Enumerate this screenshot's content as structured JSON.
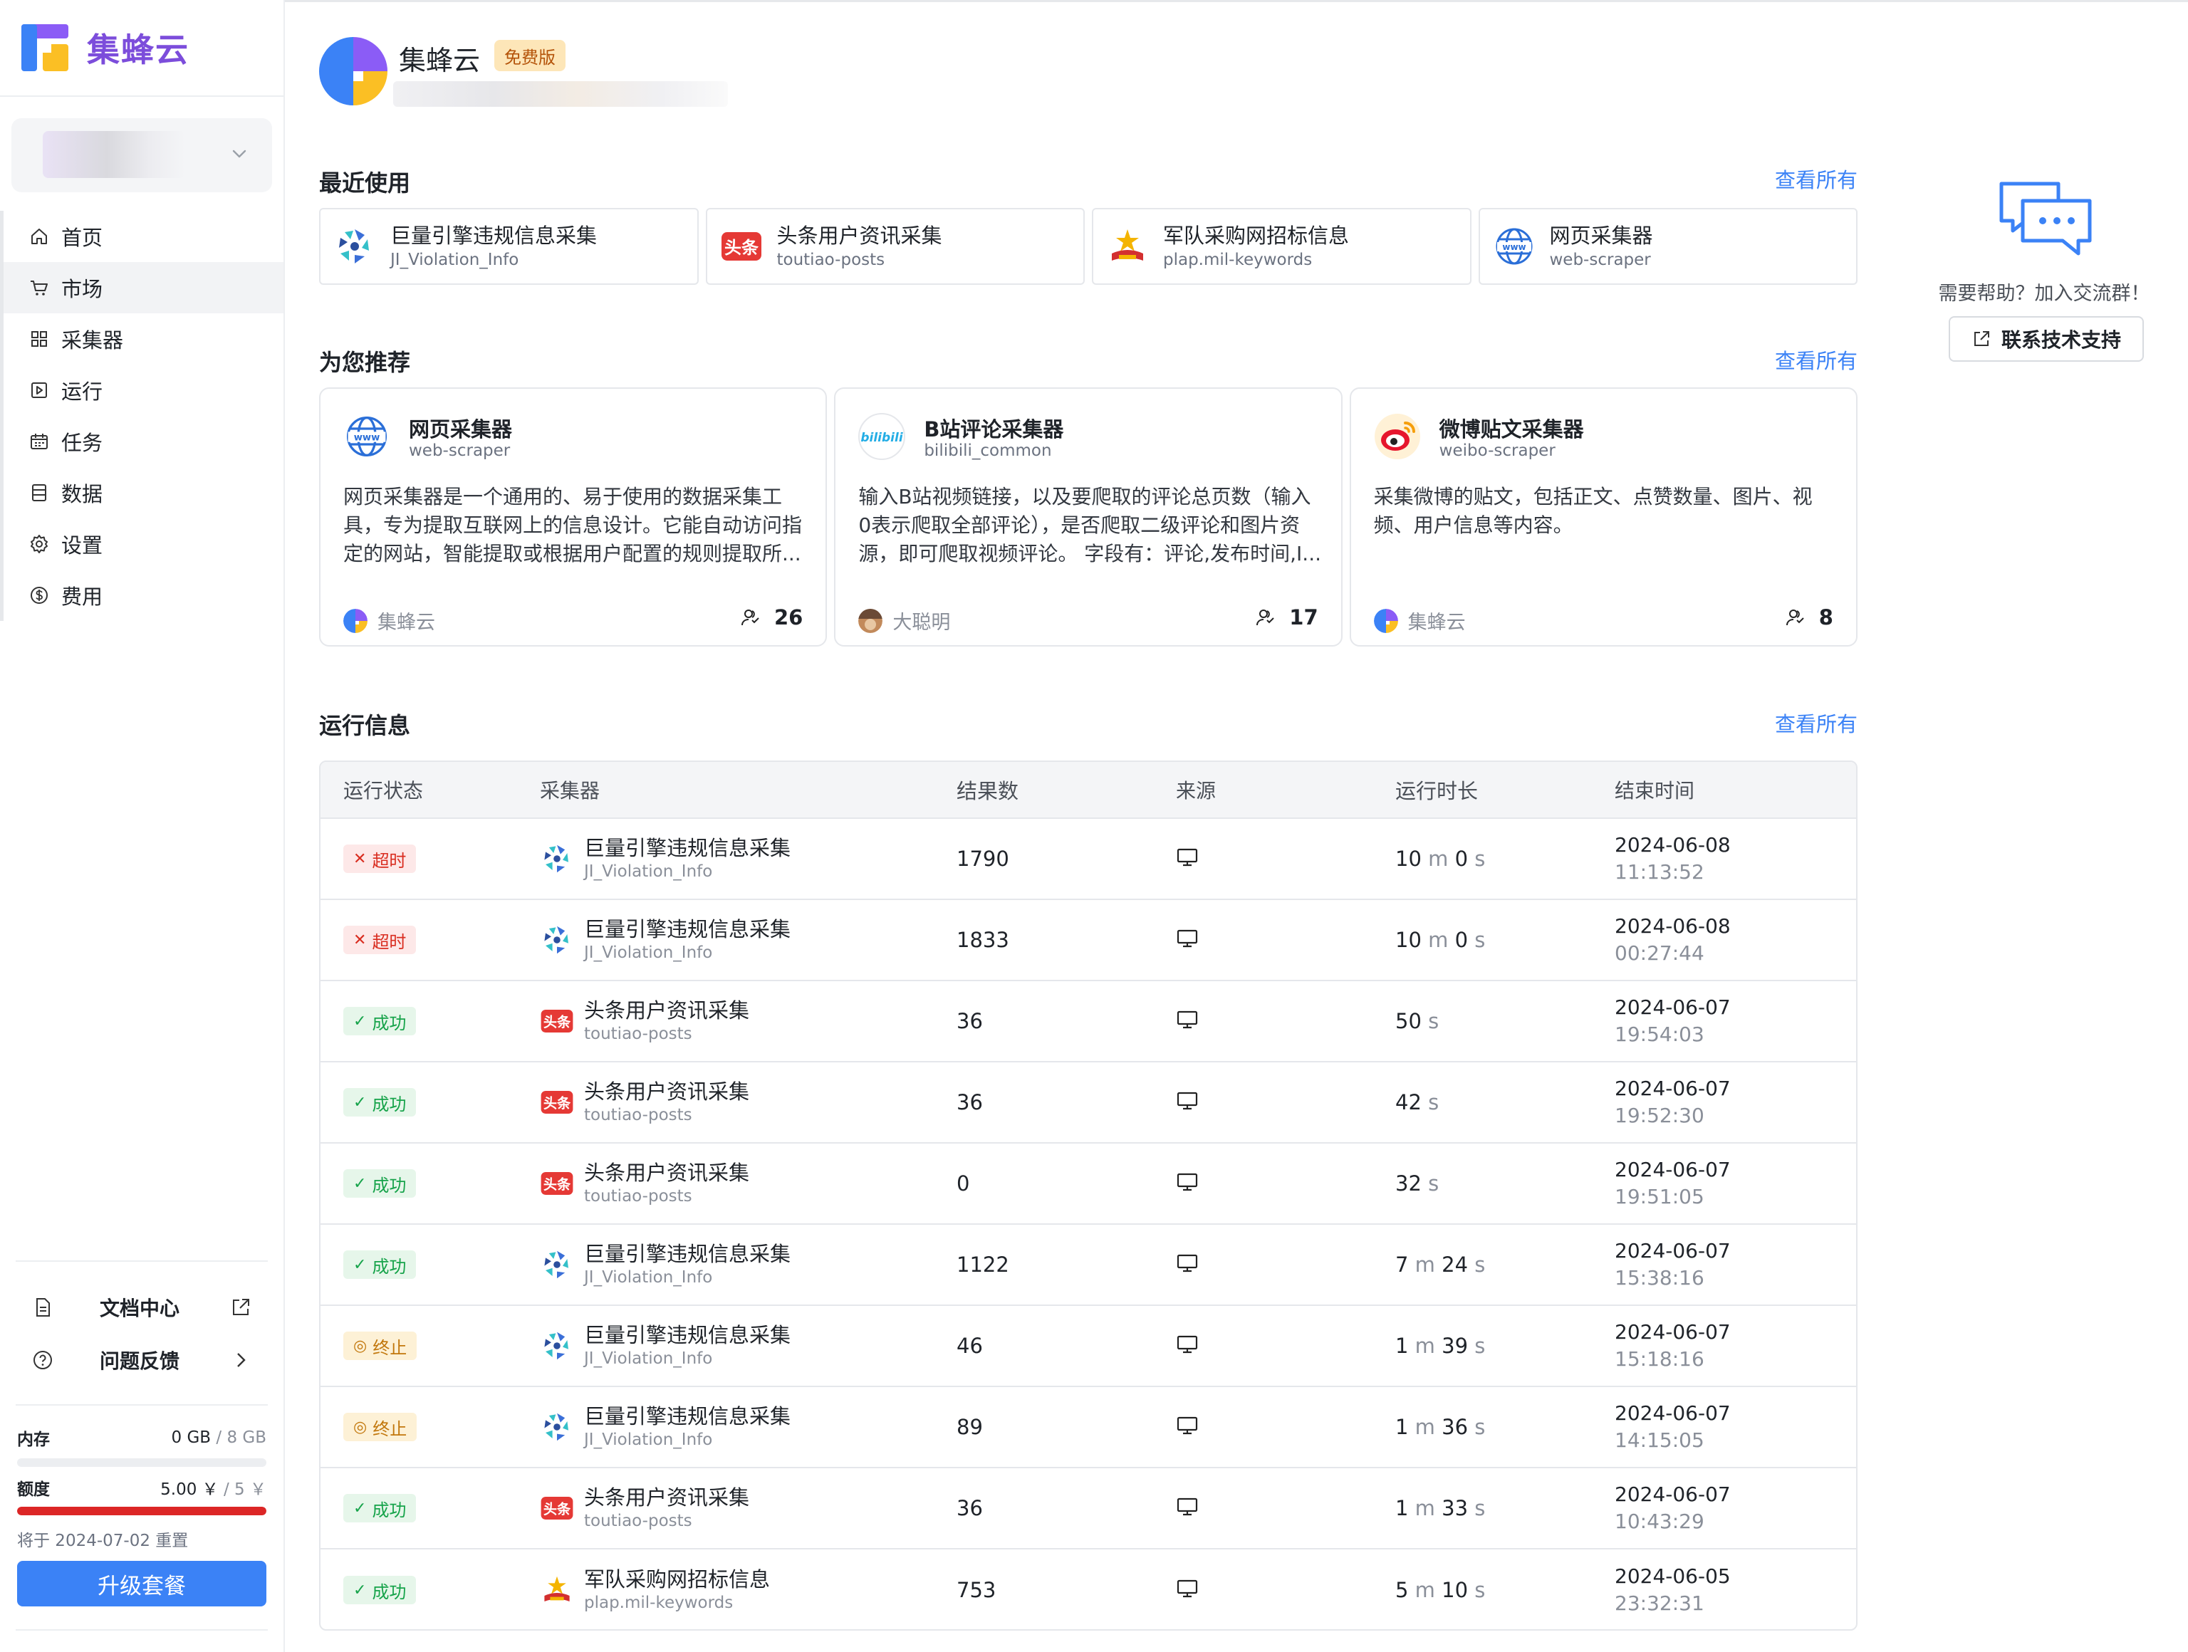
{
  "brand": {
    "name": "集蜂云"
  },
  "nav": {
    "items": [
      {
        "label": "首页",
        "icon": "home-icon"
      },
      {
        "label": "市场",
        "icon": "cart-icon"
      },
      {
        "label": "采集器",
        "icon": "grid-icon"
      },
      {
        "label": "运行",
        "icon": "play-icon"
      },
      {
        "label": "任务",
        "icon": "calendar-icon"
      },
      {
        "label": "数据",
        "icon": "database-icon"
      },
      {
        "label": "设置",
        "icon": "gear-icon"
      },
      {
        "label": "费用",
        "icon": "dollar-icon"
      }
    ],
    "active_index": 1
  },
  "footer": {
    "docs_label": "文档中心",
    "feedback_label": "问题反馈",
    "memory_label": "内存",
    "memory_used": "0 GB",
    "memory_total": "/ 8 GB",
    "memory_fraction": 0.0,
    "quota_label": "额度",
    "quota_used": "5.00 ￥",
    "quota_total": "/ 5 ￥",
    "quota_fraction": 1.0,
    "reset_text": "将于 2024-07-02 重置",
    "upgrade_label": "升级套餐"
  },
  "header": {
    "org_name": "集蜂云",
    "plan_badge": "免费版"
  },
  "recent": {
    "title": "最近使用",
    "see_all": "查看所有",
    "items": [
      {
        "name": "巨量引擎违规信息采集",
        "slug": "JI_Violation_Info",
        "icon": "juliang-icon"
      },
      {
        "name": "头条用户资讯采集",
        "slug": "toutiao-posts",
        "icon": "toutiao-icon"
      },
      {
        "name": "军队采购网招标信息",
        "slug": "plap.mil-keywords",
        "icon": "military-icon"
      },
      {
        "name": "网页采集器",
        "slug": "web-scraper",
        "icon": "www-icon"
      }
    ]
  },
  "recommend": {
    "title": "为您推荐",
    "see_all": "查看所有",
    "items": [
      {
        "name": "网页采集器",
        "slug": "web-scraper",
        "icon": "www-icon",
        "desc": "网页采集器是一个通用的、易于使用的数据采集工具，专为提取互联网上的信息设计。它能自动访问指定的网站，智能提取或根据用户配置的规则提取所...",
        "author": "集蜂云",
        "users": "26"
      },
      {
        "name": "B站评论采集器",
        "slug": "bilibili_common",
        "icon": "bilibili-icon",
        "desc": "输入B站视频链接，以及要爬取的评论总页数（输入0表示爬取全部评论），是否爬取二级评论和图片资源，即可爬取视频评论。 字段有：评论,发布时间,I...",
        "author": "大聪明",
        "users": "17"
      },
      {
        "name": "微博贴文采集器",
        "slug": "weibo-scraper",
        "icon": "weibo-icon",
        "desc": "采集微博的贴文，包括正文、点赞数量、图片、视频、用户信息等内容。",
        "author": "集蜂云",
        "users": "8"
      }
    ]
  },
  "runs": {
    "title": "运行信息",
    "see_all": "查看所有",
    "columns": [
      "运行状态",
      "采集器",
      "结果数",
      "来源",
      "运行时长",
      "结束时间"
    ],
    "rows": [
      {
        "status": "超时",
        "status_type": "timeout",
        "name": "巨量引擎违规信息采集",
        "slug": "JI_Violation_Info",
        "icon": "juliang-icon",
        "results": "1790",
        "dur": [
          [
            "10",
            "m"
          ],
          [
            "0",
            "s"
          ]
        ],
        "date": "2024-06-08",
        "time": "11:13:52"
      },
      {
        "status": "超时",
        "status_type": "timeout",
        "name": "巨量引擎违规信息采集",
        "slug": "JI_Violation_Info",
        "icon": "juliang-icon",
        "results": "1833",
        "dur": [
          [
            "10",
            "m"
          ],
          [
            "0",
            "s"
          ]
        ],
        "date": "2024-06-08",
        "time": "00:27:44"
      },
      {
        "status": "成功",
        "status_type": "success",
        "name": "头条用户资讯采集",
        "slug": "toutiao-posts",
        "icon": "toutiao-icon",
        "results": "36",
        "dur": [
          [
            "50",
            "s"
          ]
        ],
        "date": "2024-06-07",
        "time": "19:54:03"
      },
      {
        "status": "成功",
        "status_type": "success",
        "name": "头条用户资讯采集",
        "slug": "toutiao-posts",
        "icon": "toutiao-icon",
        "results": "36",
        "dur": [
          [
            "42",
            "s"
          ]
        ],
        "date": "2024-06-07",
        "time": "19:52:30"
      },
      {
        "status": "成功",
        "status_type": "success",
        "name": "头条用户资讯采集",
        "slug": "toutiao-posts",
        "icon": "toutiao-icon",
        "results": "0",
        "dur": [
          [
            "32",
            "s"
          ]
        ],
        "date": "2024-06-07",
        "time": "19:51:05"
      },
      {
        "status": "成功",
        "status_type": "success",
        "name": "巨量引擎违规信息采集",
        "slug": "JI_Violation_Info",
        "icon": "juliang-icon",
        "results": "1122",
        "dur": [
          [
            "7",
            "m"
          ],
          [
            "24",
            "s"
          ]
        ],
        "date": "2024-06-07",
        "time": "15:38:16"
      },
      {
        "status": "终止",
        "status_type": "stopped",
        "name": "巨量引擎违规信息采集",
        "slug": "JI_Violation_Info",
        "icon": "juliang-icon",
        "results": "46",
        "dur": [
          [
            "1",
            "m"
          ],
          [
            "39",
            "s"
          ]
        ],
        "date": "2024-06-07",
        "time": "15:18:16"
      },
      {
        "status": "终止",
        "status_type": "stopped",
        "name": "巨量引擎违规信息采集",
        "slug": "JI_Violation_Info",
        "icon": "juliang-icon",
        "results": "89",
        "dur": [
          [
            "1",
            "m"
          ],
          [
            "36",
            "s"
          ]
        ],
        "date": "2024-06-07",
        "time": "14:15:05"
      },
      {
        "status": "成功",
        "status_type": "success",
        "name": "头条用户资讯采集",
        "slug": "toutiao-posts",
        "icon": "toutiao-icon",
        "results": "36",
        "dur": [
          [
            "1",
            "m"
          ],
          [
            "33",
            "s"
          ]
        ],
        "date": "2024-06-07",
        "time": "10:43:29"
      },
      {
        "status": "成功",
        "status_type": "success",
        "name": "军队采购网招标信息",
        "slug": "plap.mil-keywords",
        "icon": "military-icon",
        "results": "753",
        "dur": [
          [
            "5",
            "m"
          ],
          [
            "10",
            "s"
          ]
        ],
        "date": "2024-06-05",
        "time": "23:32:31"
      }
    ]
  },
  "help": {
    "text": "需要帮助？加入交流群！",
    "button": "联系技术支持"
  },
  "colors": {
    "brand": "#7c4ddb",
    "accent": "#3b82f6",
    "danger": "#dc2626"
  }
}
